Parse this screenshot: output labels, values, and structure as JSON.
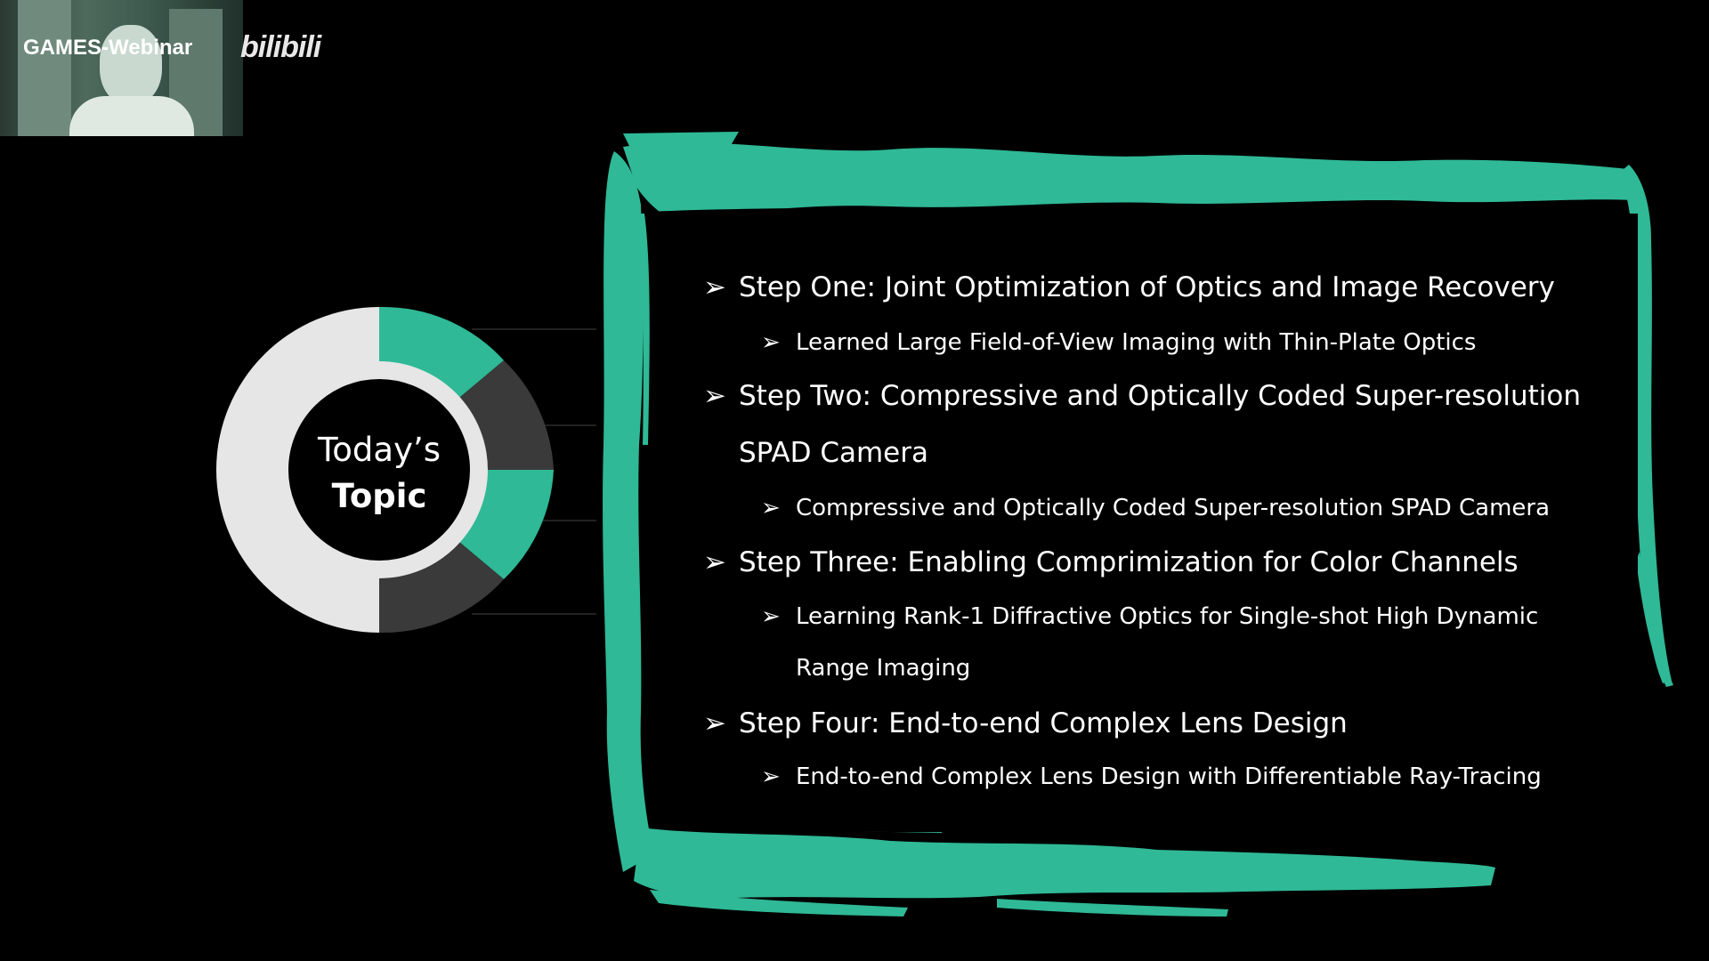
{
  "watermark": {
    "channel_label": "GAMES-Webinar",
    "logo_text": "bilibili"
  },
  "topic": {
    "line1": "Today’s",
    "line2": "Topic"
  },
  "agenda": {
    "step1": "Step One: Joint Optimization of Optics and Image Recovery",
    "step1_sub": "Learned Large Field-of-View Imaging  with Thin-Plate Optics",
    "step2_line1": "Step Two: Compressive and Optically Coded Super-resolution",
    "step2_line2": "SPAD Camera",
    "step2_sub": "Compressive and Optically Coded Super-resolution SPAD Camera",
    "step3": "Step Three: Enabling Comprimization for Color Channels",
    "step3_sub_line1": "Learning Rank-1 Diffractive Optics for Single-shot High Dynamic",
    "step3_sub_line2": "Range Imaging",
    "step4": "Step Four: End-to-end Complex Lens Design",
    "step4_sub": "End-to-end Complex Lens Design with Differentiable Ray-Tracing"
  },
  "colors": {
    "accent": "#2fb996",
    "dark_segment": "#3a3a3a",
    "light_ring": "#e6e6e6",
    "background": "#000000"
  },
  "icons": {
    "bullet": "arrow-bullet-icon"
  }
}
